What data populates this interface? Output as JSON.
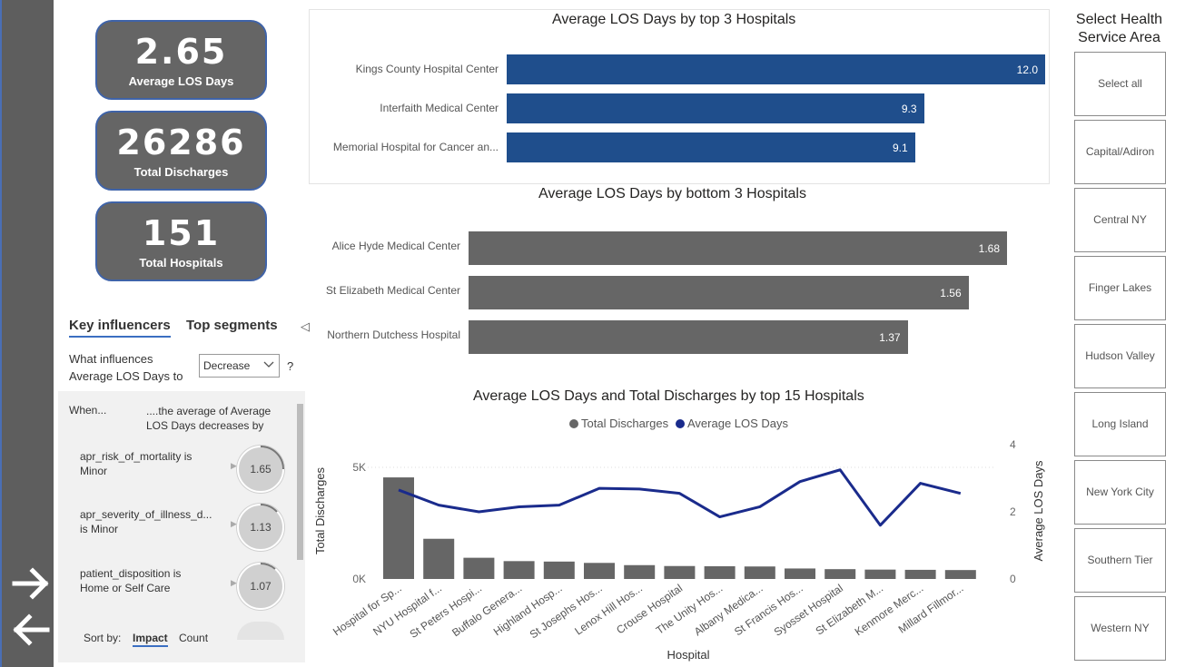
{
  "kpis": [
    {
      "value": "2.65",
      "label": "Average LOS Days"
    },
    {
      "value": "26286",
      "label": "Total Discharges"
    },
    {
      "value": "151",
      "label": "Total Hospitals"
    }
  ],
  "key_influencers": {
    "tab_active": "Key influencers",
    "tab_other": "Top segments",
    "question_line1": "What influences",
    "question_line2": "Average LOS Days to",
    "dropdown_value": "Decrease",
    "help": "?",
    "collapse_glyph": "◁",
    "col_when": "When...",
    "col_effect": "....the average of Average LOS Days decreases by",
    "rows": [
      {
        "text": "apr_risk_of_mortality is Minor",
        "value": "1.65"
      },
      {
        "text": "apr_severity_of_illness_d... is Minor",
        "value": "1.13"
      },
      {
        "text": "patient_disposition is Home or Self Care",
        "value": "1.07"
      }
    ],
    "sort_label": "Sort by:",
    "sort_impact": "Impact",
    "sort_count": "Count"
  },
  "top3": {
    "title": "Average LOS Days by top 3 Hospitals",
    "color": "#1f4e8c",
    "bars": [
      {
        "label": "Kings County Hospital Center",
        "value": 12.0,
        "display": "12.0"
      },
      {
        "label": "Interfaith Medical Center",
        "value": 9.3,
        "display": "9.3"
      },
      {
        "label": "Memorial Hospital for Cancer an...",
        "value": 9.1,
        "display": "9.1"
      }
    ]
  },
  "bottom3": {
    "title": "Average LOS Days by bottom 3 Hospitals",
    "color": "#666666",
    "bars": [
      {
        "label": "Alice Hyde Medical Center",
        "value": 1.68,
        "display": "1.68"
      },
      {
        "label": "St Elizabeth Medical Center",
        "value": 1.56,
        "display": "1.56"
      },
      {
        "label": "Northern Dutchess Hospital",
        "value": 1.37,
        "display": "1.37"
      }
    ]
  },
  "combo": {
    "title": "Average LOS Days and Total Discharges by top 15 Hospitals",
    "legend_bar": "Total Discharges",
    "legend_line": "Average LOS Days",
    "bar_color": "#666666",
    "line_color": "#1a2b8c",
    "y_left_label": "Total Discharges",
    "y_right_label": "Average LOS Days",
    "x_label": "Hospital",
    "y_left_ticks": [
      "0K",
      "5K"
    ],
    "y_right_ticks": [
      "0",
      "2",
      "4"
    ]
  },
  "chart_data": {
    "type": "bar",
    "title": "Average LOS Days and Total Discharges by top 15 Hospitals",
    "xlabel": "Hospital",
    "ylabel": "Total Discharges",
    "y2label": "Average LOS Days",
    "ylim": [
      0,
      6500
    ],
    "y2lim": [
      0,
      4
    ],
    "categories": [
      "Hospital for Sp...",
      "NYU Hospital f...",
      "St Peters Hospi...",
      "Buffalo Genera...",
      "Highland Hosp...",
      "St Josephs Hos...",
      "Lenox Hill Hos...",
      "Crouse Hospital",
      "The Unity Hos...",
      "Albany Medica...",
      "St Francis Hos...",
      "Syosset Hospital",
      "St Elizabeth M...",
      "Kenmore Merc...",
      "Millard Fillmor..."
    ],
    "series": [
      {
        "name": "Total Discharges",
        "type": "bar",
        "axis": "left",
        "values": [
          4550,
          1800,
          950,
          800,
          780,
          720,
          620,
          580,
          570,
          560,
          470,
          440,
          420,
          410,
          400
        ]
      },
      {
        "name": "Average LOS Days",
        "type": "line",
        "axis": "right",
        "values": [
          2.65,
          2.2,
          2.0,
          2.15,
          2.2,
          2.7,
          2.68,
          2.55,
          1.85,
          2.15,
          2.9,
          3.25,
          1.6,
          2.85,
          2.55
        ]
      }
    ]
  },
  "slicer": {
    "title": "Select Health Service Area",
    "items": [
      "Select all",
      "Capital/Adiron",
      "Central NY",
      "Finger Lakes",
      "Hudson Valley",
      "Long Island",
      "New York City",
      "Southern Tier",
      "Western NY"
    ]
  }
}
